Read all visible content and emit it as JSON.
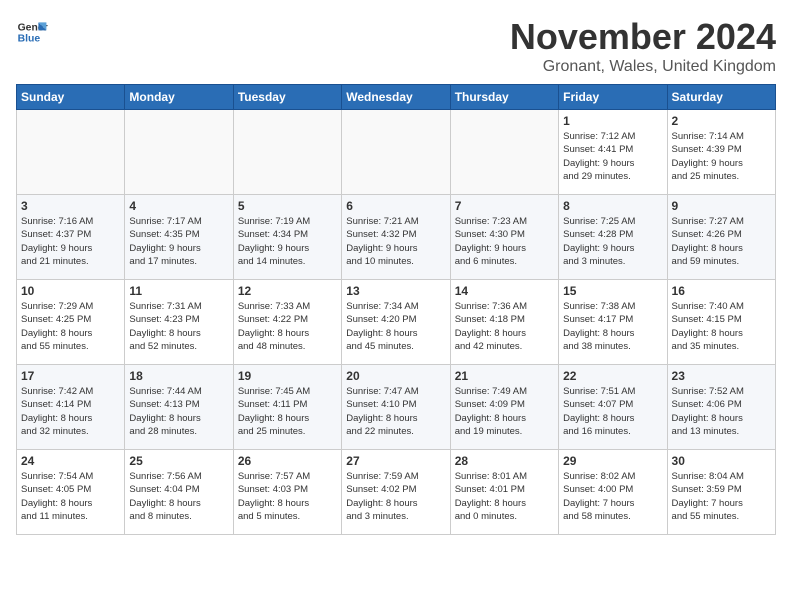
{
  "header": {
    "logo_line1": "General",
    "logo_line2": "Blue",
    "month_title": "November 2024",
    "location": "Gronant, Wales, United Kingdom"
  },
  "weekdays": [
    "Sunday",
    "Monday",
    "Tuesday",
    "Wednesday",
    "Thursday",
    "Friday",
    "Saturday"
  ],
  "weeks": [
    [
      {
        "day": "",
        "info": ""
      },
      {
        "day": "",
        "info": ""
      },
      {
        "day": "",
        "info": ""
      },
      {
        "day": "",
        "info": ""
      },
      {
        "day": "",
        "info": ""
      },
      {
        "day": "1",
        "info": "Sunrise: 7:12 AM\nSunset: 4:41 PM\nDaylight: 9 hours\nand 29 minutes."
      },
      {
        "day": "2",
        "info": "Sunrise: 7:14 AM\nSunset: 4:39 PM\nDaylight: 9 hours\nand 25 minutes."
      }
    ],
    [
      {
        "day": "3",
        "info": "Sunrise: 7:16 AM\nSunset: 4:37 PM\nDaylight: 9 hours\nand 21 minutes."
      },
      {
        "day": "4",
        "info": "Sunrise: 7:17 AM\nSunset: 4:35 PM\nDaylight: 9 hours\nand 17 minutes."
      },
      {
        "day": "5",
        "info": "Sunrise: 7:19 AM\nSunset: 4:34 PM\nDaylight: 9 hours\nand 14 minutes."
      },
      {
        "day": "6",
        "info": "Sunrise: 7:21 AM\nSunset: 4:32 PM\nDaylight: 9 hours\nand 10 minutes."
      },
      {
        "day": "7",
        "info": "Sunrise: 7:23 AM\nSunset: 4:30 PM\nDaylight: 9 hours\nand 6 minutes."
      },
      {
        "day": "8",
        "info": "Sunrise: 7:25 AM\nSunset: 4:28 PM\nDaylight: 9 hours\nand 3 minutes."
      },
      {
        "day": "9",
        "info": "Sunrise: 7:27 AM\nSunset: 4:26 PM\nDaylight: 8 hours\nand 59 minutes."
      }
    ],
    [
      {
        "day": "10",
        "info": "Sunrise: 7:29 AM\nSunset: 4:25 PM\nDaylight: 8 hours\nand 55 minutes."
      },
      {
        "day": "11",
        "info": "Sunrise: 7:31 AM\nSunset: 4:23 PM\nDaylight: 8 hours\nand 52 minutes."
      },
      {
        "day": "12",
        "info": "Sunrise: 7:33 AM\nSunset: 4:22 PM\nDaylight: 8 hours\nand 48 minutes."
      },
      {
        "day": "13",
        "info": "Sunrise: 7:34 AM\nSunset: 4:20 PM\nDaylight: 8 hours\nand 45 minutes."
      },
      {
        "day": "14",
        "info": "Sunrise: 7:36 AM\nSunset: 4:18 PM\nDaylight: 8 hours\nand 42 minutes."
      },
      {
        "day": "15",
        "info": "Sunrise: 7:38 AM\nSunset: 4:17 PM\nDaylight: 8 hours\nand 38 minutes."
      },
      {
        "day": "16",
        "info": "Sunrise: 7:40 AM\nSunset: 4:15 PM\nDaylight: 8 hours\nand 35 minutes."
      }
    ],
    [
      {
        "day": "17",
        "info": "Sunrise: 7:42 AM\nSunset: 4:14 PM\nDaylight: 8 hours\nand 32 minutes."
      },
      {
        "day": "18",
        "info": "Sunrise: 7:44 AM\nSunset: 4:13 PM\nDaylight: 8 hours\nand 28 minutes."
      },
      {
        "day": "19",
        "info": "Sunrise: 7:45 AM\nSunset: 4:11 PM\nDaylight: 8 hours\nand 25 minutes."
      },
      {
        "day": "20",
        "info": "Sunrise: 7:47 AM\nSunset: 4:10 PM\nDaylight: 8 hours\nand 22 minutes."
      },
      {
        "day": "21",
        "info": "Sunrise: 7:49 AM\nSunset: 4:09 PM\nDaylight: 8 hours\nand 19 minutes."
      },
      {
        "day": "22",
        "info": "Sunrise: 7:51 AM\nSunset: 4:07 PM\nDaylight: 8 hours\nand 16 minutes."
      },
      {
        "day": "23",
        "info": "Sunrise: 7:52 AM\nSunset: 4:06 PM\nDaylight: 8 hours\nand 13 minutes."
      }
    ],
    [
      {
        "day": "24",
        "info": "Sunrise: 7:54 AM\nSunset: 4:05 PM\nDaylight: 8 hours\nand 11 minutes."
      },
      {
        "day": "25",
        "info": "Sunrise: 7:56 AM\nSunset: 4:04 PM\nDaylight: 8 hours\nand 8 minutes."
      },
      {
        "day": "26",
        "info": "Sunrise: 7:57 AM\nSunset: 4:03 PM\nDaylight: 8 hours\nand 5 minutes."
      },
      {
        "day": "27",
        "info": "Sunrise: 7:59 AM\nSunset: 4:02 PM\nDaylight: 8 hours\nand 3 minutes."
      },
      {
        "day": "28",
        "info": "Sunrise: 8:01 AM\nSunset: 4:01 PM\nDaylight: 8 hours\nand 0 minutes."
      },
      {
        "day": "29",
        "info": "Sunrise: 8:02 AM\nSunset: 4:00 PM\nDaylight: 7 hours\nand 58 minutes."
      },
      {
        "day": "30",
        "info": "Sunrise: 8:04 AM\nSunset: 3:59 PM\nDaylight: 7 hours\nand 55 minutes."
      }
    ]
  ]
}
